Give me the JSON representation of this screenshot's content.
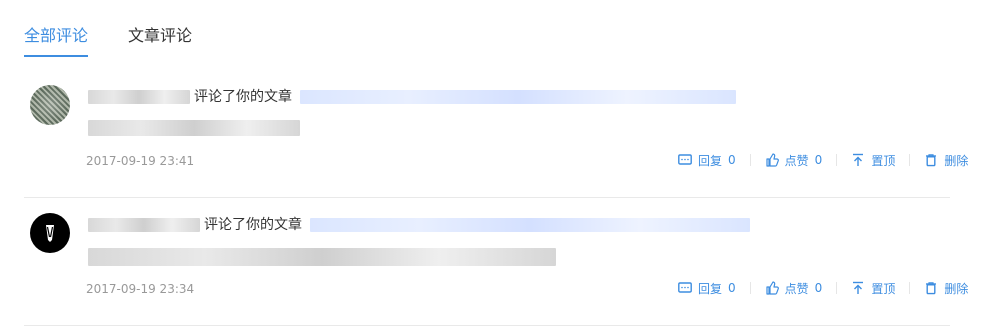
{
  "tabs": {
    "all": "全部评论",
    "article": "文章评论"
  },
  "comments": [
    {
      "text_prefix": "评论了你的文章",
      "date": "2017-09-19 23:41",
      "reply_label": "回复",
      "reply_count": "0",
      "like_label": "点赞",
      "like_count": "0",
      "pin_label": "置顶",
      "delete_label": "删除",
      "avatar_icon": "pattern-avatar"
    },
    {
      "text_prefix": "评论了你的文章",
      "date": "2017-09-19 23:34",
      "reply_label": "回复",
      "reply_count": "0",
      "like_label": "点赞",
      "like_count": "0",
      "pin_label": "置顶",
      "delete_label": "删除",
      "avatar_icon": "dark-avatar"
    }
  ],
  "colors": {
    "accent": "#3d8de0",
    "muted": "#999999",
    "text": "#333333"
  },
  "icons": {
    "reply": "comment-icon",
    "like": "thumbs-up-icon",
    "pin": "pin-top-icon",
    "delete": "trash-icon"
  }
}
